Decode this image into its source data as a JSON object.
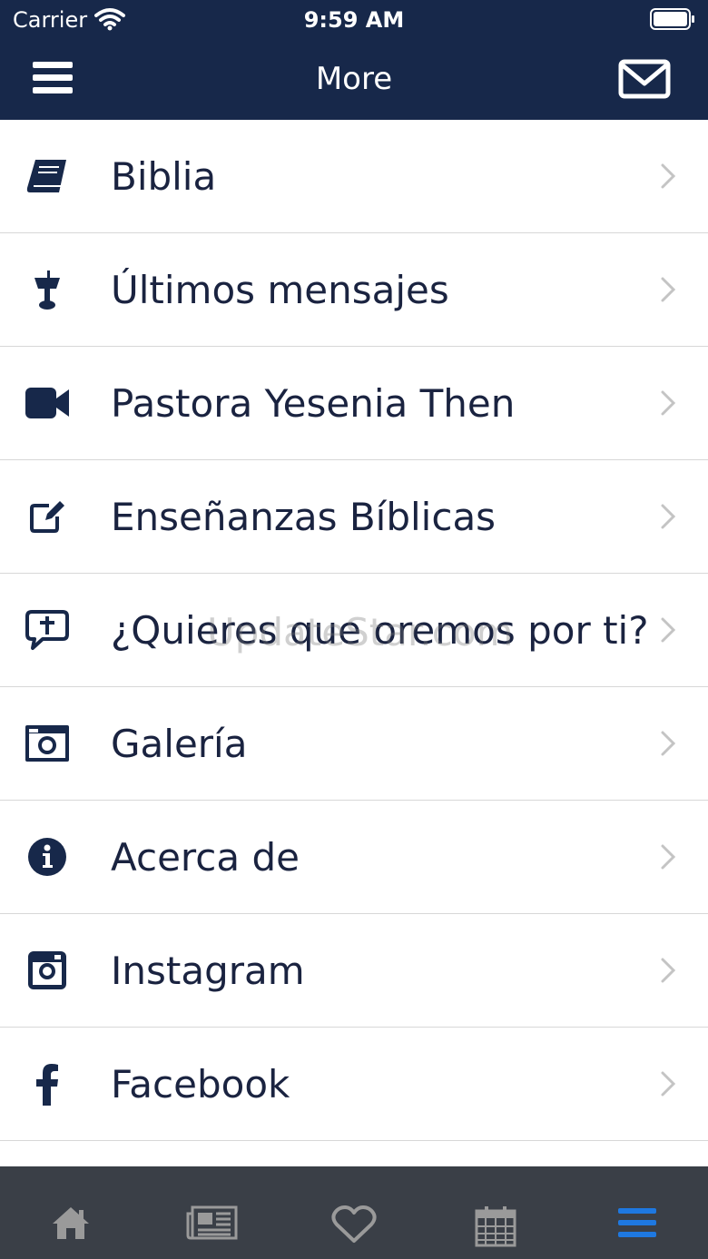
{
  "status_bar": {
    "carrier": "Carrier",
    "time": "9:59 AM"
  },
  "nav": {
    "title": "More"
  },
  "colors": {
    "nav_background": "#17284a",
    "icon": "#17284a",
    "tabbar_background": "#3a3f47",
    "tab_active": "#1e78e0",
    "tab_inactive": "#9a9a9a"
  },
  "menu": {
    "items": [
      {
        "label": "Biblia",
        "icon": "book-icon"
      },
      {
        "label": "Últimos mensajes",
        "icon": "podium-icon"
      },
      {
        "label": "Pastora Yesenia Then",
        "icon": "video-camera-icon"
      },
      {
        "label": "Enseñanzas Bíblicas",
        "icon": "edit-icon"
      },
      {
        "label": "¿Quieres que oremos por ti?",
        "icon": "prayer-chat-icon"
      },
      {
        "label": "Galería",
        "icon": "camera-icon"
      },
      {
        "label": "Acerca de",
        "icon": "info-icon"
      },
      {
        "label": "Instagram",
        "icon": "instagram-icon"
      },
      {
        "label": "Facebook",
        "icon": "facebook-icon"
      }
    ]
  },
  "watermark": "UpdateStar.com",
  "tabbar": {
    "tabs": [
      {
        "icon": "home-icon",
        "active": false
      },
      {
        "icon": "news-icon",
        "active": false
      },
      {
        "icon": "heart-icon",
        "active": false
      },
      {
        "icon": "calendar-icon",
        "active": false
      },
      {
        "icon": "more-menu-icon",
        "active": true
      }
    ]
  }
}
